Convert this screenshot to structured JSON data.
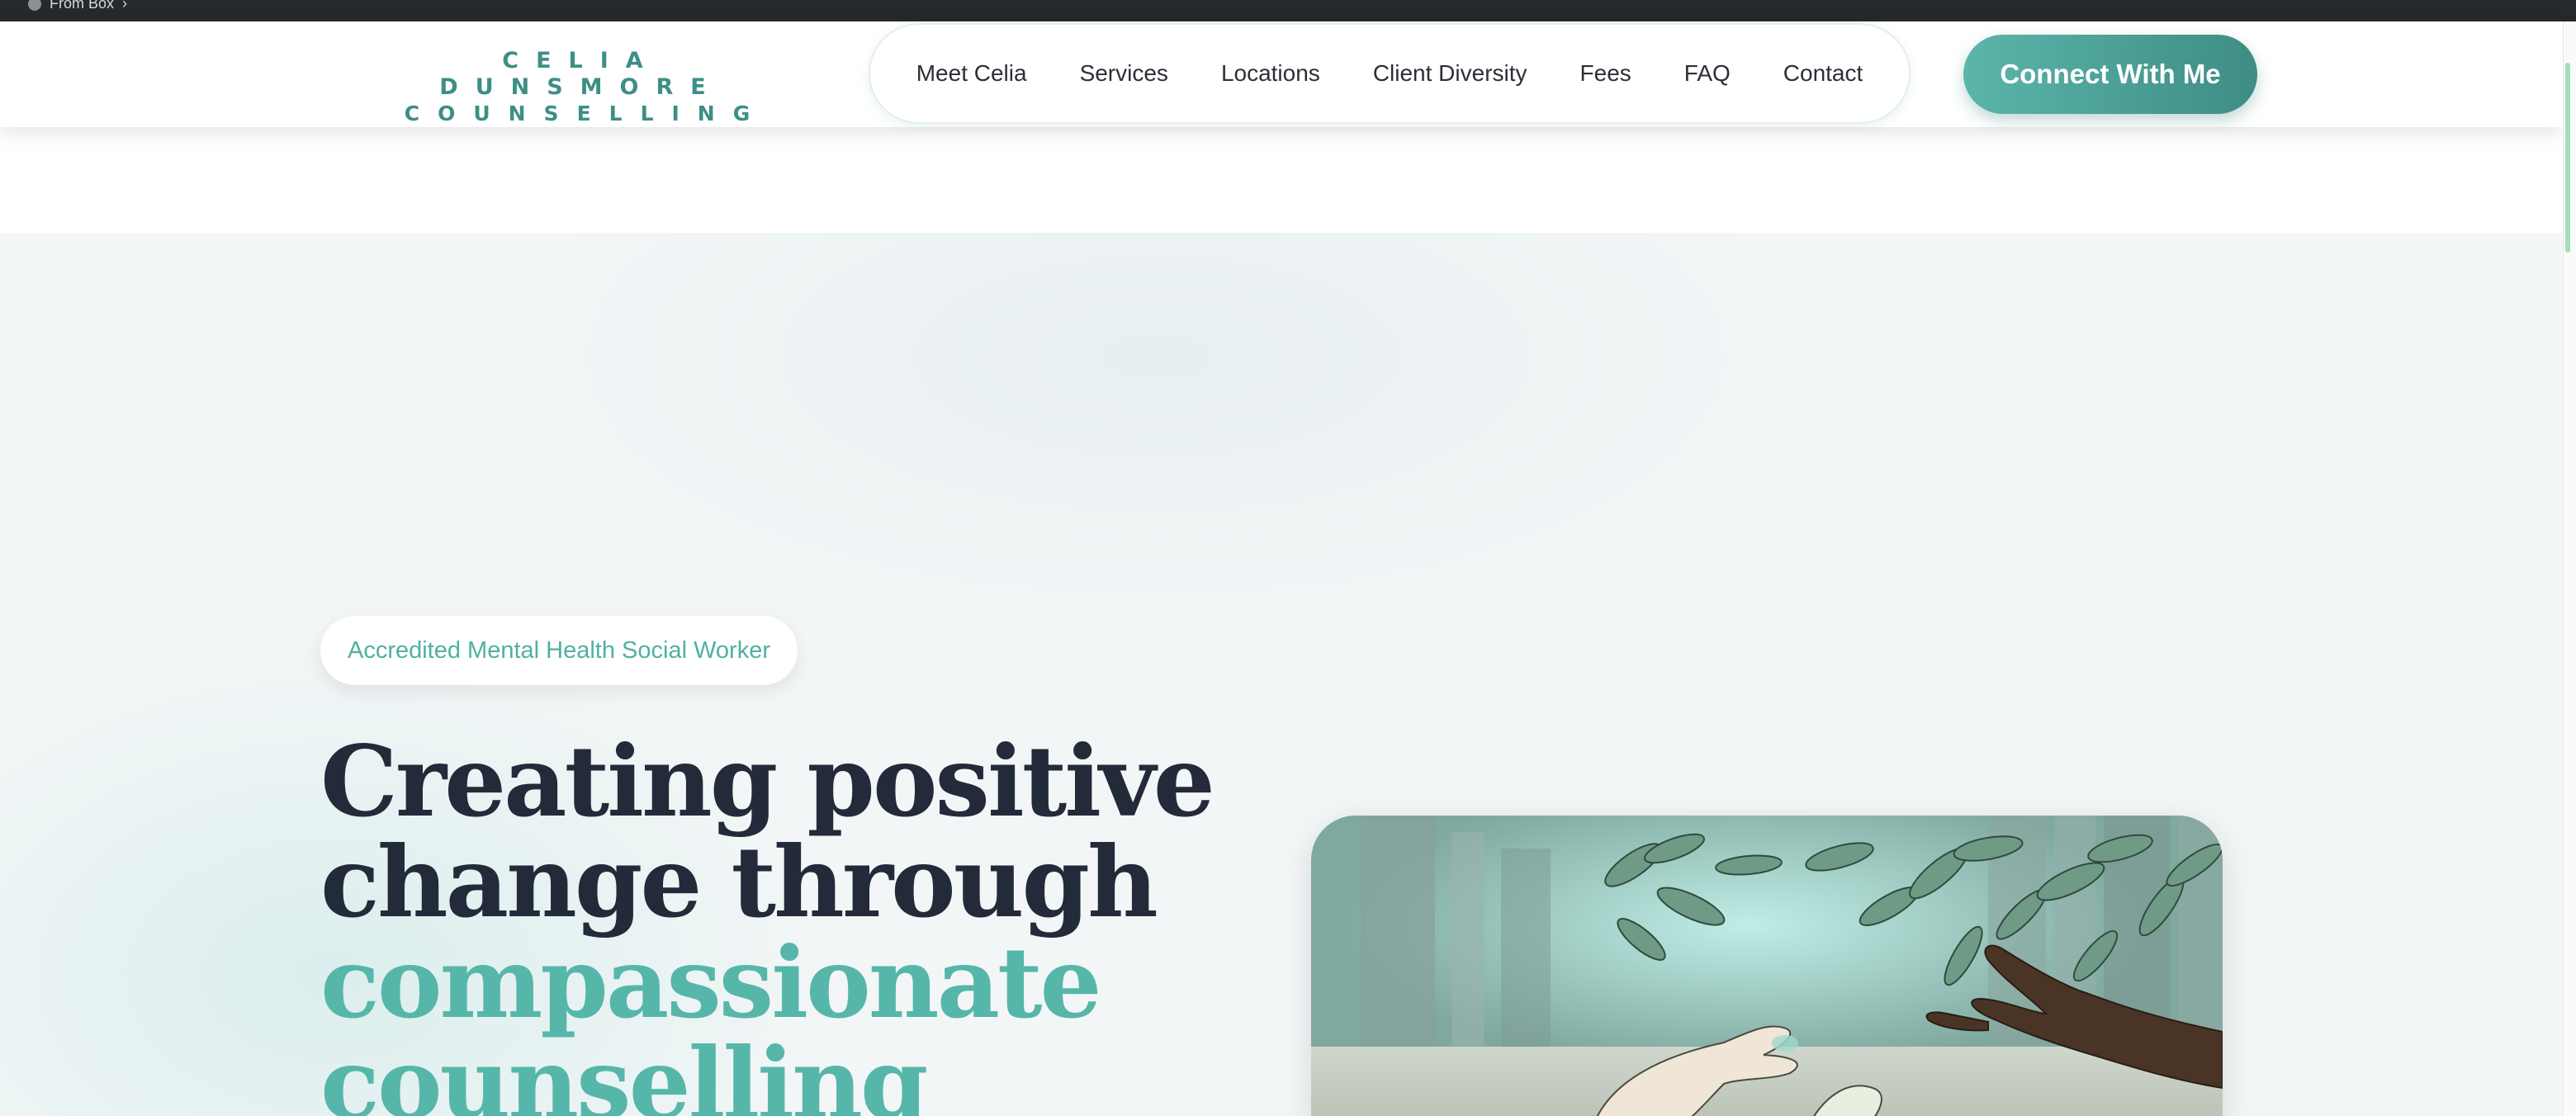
{
  "browser": {
    "breadcrumb_label": "From Box",
    "breadcrumb_icon": "box-icon",
    "chevron_icon": "chevron-right-icon"
  },
  "header": {
    "logo_line1": "CELIA DUNSMORE",
    "logo_line2": "COUNSELLING",
    "nav": [
      {
        "label": "Meet Celia"
      },
      {
        "label": "Services"
      },
      {
        "label": "Locations"
      },
      {
        "label": "Client Diversity"
      },
      {
        "label": "Fees"
      },
      {
        "label": "FAQ"
      },
      {
        "label": "Contact"
      }
    ],
    "cta_label": "Connect With Me"
  },
  "hero": {
    "badge": "Accredited Mental Health Social Worker",
    "headline_line1": "Creating positive",
    "headline_line2": "change through",
    "headline_line3": "compassionate",
    "headline_line4": "counselling"
  },
  "colors": {
    "accent": "#4fb0a4",
    "accent_dark": "#3e8d84",
    "heading": "#232b3a",
    "topbar": "#26292b"
  }
}
